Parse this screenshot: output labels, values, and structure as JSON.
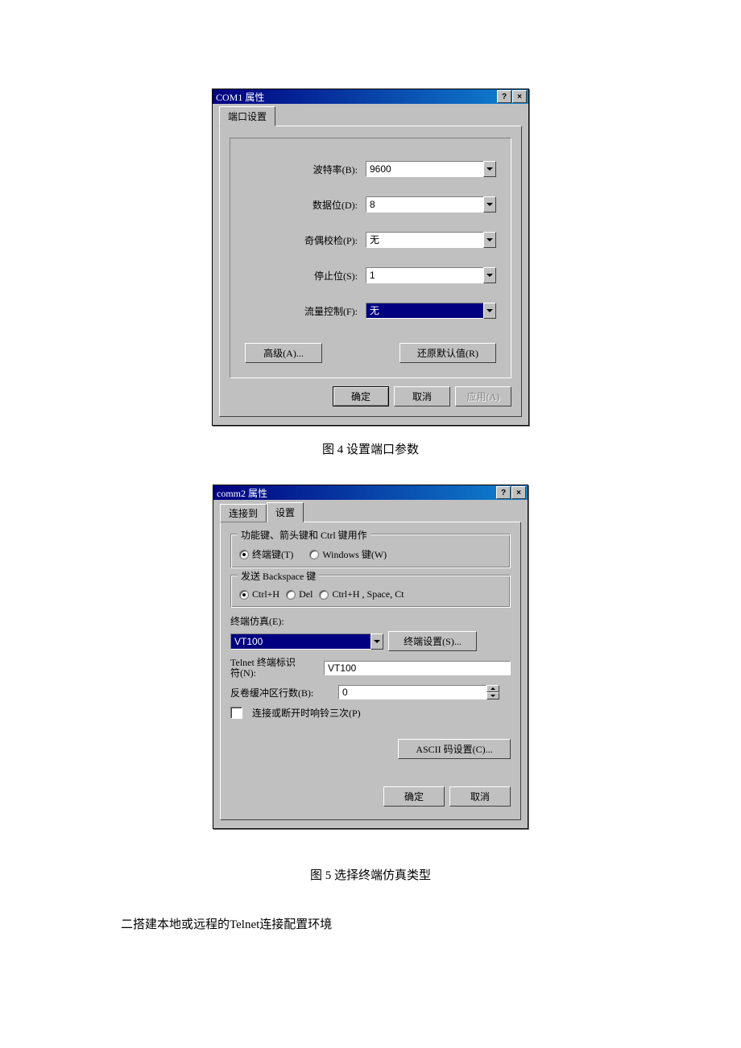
{
  "dialog1": {
    "title": "COM1 属性",
    "help_btn": "?",
    "close_btn": "×",
    "tab": "端口设置",
    "fields": {
      "baud": {
        "label": "波特率(B):",
        "value": "9600"
      },
      "databits": {
        "label": "数据位(D):",
        "value": "8"
      },
      "parity": {
        "label": "奇偶校检(P):",
        "value": "无"
      },
      "stopbits": {
        "label": "停止位(S):",
        "value": "1"
      },
      "flowctrl": {
        "label": "流量控制(F):",
        "value": "无"
      }
    },
    "buttons": {
      "advanced": "高级(A)...",
      "restore": "还原默认值(R)",
      "ok": "确定",
      "cancel": "取消",
      "apply": "应用(A)"
    }
  },
  "caption1": "图 4 设置端口参数",
  "dialog2": {
    "title": "comm2 属性",
    "help_btn": "?",
    "close_btn": "×",
    "tabs": {
      "connect": "连接到",
      "settings": "设置"
    },
    "group_funckeys": {
      "legend": "功能键、箭头键和 Ctrl 键用作",
      "opt1": "终端键(T)",
      "opt2": "Windows 键(W)"
    },
    "group_backspace": {
      "legend": "发送 Backspace 键",
      "opt1": "Ctrl+H",
      "opt2": "Del",
      "opt3": "Ctrl+H , Space, Ct"
    },
    "emulation_label": "终端仿真(E):",
    "emulation_value": "VT100",
    "emulation_btn": "终端设置(S)...",
    "telnet_label_a": "Telnet 终端标识",
    "telnet_label_b": "符(N):",
    "telnet_value": "VT100",
    "scrollback_label": "反卷缓冲区行数(B):",
    "scrollback_value": "0",
    "ring_label": "连接或断开时响铃三次(P)",
    "ascii_btn": "ASCII 码设置(C)...",
    "ok": "确定",
    "cancel": "取消"
  },
  "caption2": "图 5 选择终端仿真类型",
  "heading": "二搭建本地或远程的Telnet连接配置环境"
}
